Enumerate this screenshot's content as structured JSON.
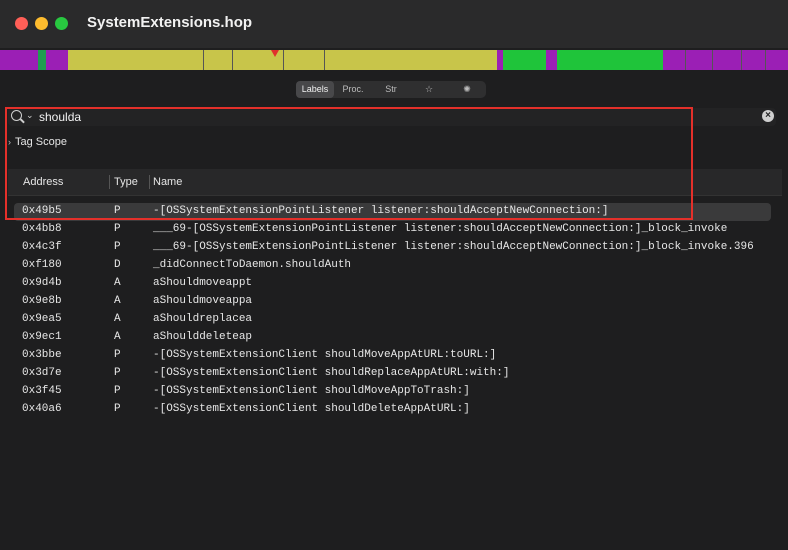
{
  "window": {
    "title": "SystemExtensions.hop"
  },
  "nav_segments": [
    {
      "color": "#9b1fb5",
      "start": 0,
      "end": 38
    },
    {
      "color": "#1f9e50",
      "start": 38,
      "end": 46
    },
    {
      "color": "#9b1fb5",
      "start": 46,
      "end": 68
    },
    {
      "color": "#c8c54a",
      "start": 68,
      "end": 497
    },
    {
      "color": "#9b1fb5",
      "start": 497,
      "end": 503
    },
    {
      "color": "#1fc43a",
      "start": 503,
      "end": 546
    },
    {
      "color": "#9b1fb5",
      "start": 546,
      "end": 557
    },
    {
      "color": "#1fc43a",
      "start": 557,
      "end": 663
    },
    {
      "color": "#9b1fb5",
      "start": 663,
      "end": 788
    }
  ],
  "tabs": [
    "Labels",
    "Proc.",
    "Str",
    "☆",
    "✺"
  ],
  "search": {
    "value": "shoulda"
  },
  "tag_scope": {
    "label": "Tag Scope"
  },
  "columns": {
    "address": "Address",
    "type": "Type",
    "name": "Name"
  },
  "rows": [
    {
      "address": "0x49b5",
      "type": "P",
      "name": "-[OSSystemExtensionPointListener listener:shouldAcceptNewConnection:]"
    },
    {
      "address": "0x4bb8",
      "type": "P",
      "name": "___69-[OSSystemExtensionPointListener listener:shouldAcceptNewConnection:]_block_invoke"
    },
    {
      "address": "0x4c3f",
      "type": "P",
      "name": "___69-[OSSystemExtensionPointListener listener:shouldAcceptNewConnection:]_block_invoke.396"
    },
    {
      "address": "0xf180",
      "type": "D",
      "name": "_didConnectToDaemon.shouldAuth"
    },
    {
      "address": "0x9d4b",
      "type": "A",
      "name": "aShouldmoveappt"
    },
    {
      "address": "0x9e8b",
      "type": "A",
      "name": "aShouldmoveappa"
    },
    {
      "address": "0x9ea5",
      "type": "A",
      "name": "aShouldreplacea"
    },
    {
      "address": "0x9ec1",
      "type": "A",
      "name": "aShoulddeleteap"
    },
    {
      "address": "0x3bbe",
      "type": "P",
      "name": "-[OSSystemExtensionClient shouldMoveAppAtURL:toURL:]"
    },
    {
      "address": "0x3d7e",
      "type": "P",
      "name": "-[OSSystemExtensionClient shouldReplaceAppAtURL:with:]"
    },
    {
      "address": "0x3f45",
      "type": "P",
      "name": "-[OSSystemExtensionClient shouldMoveAppToTrash:]"
    },
    {
      "address": "0x40a6",
      "type": "P",
      "name": "-[OSSystemExtensionClient shouldDeleteAppAtURL:]"
    }
  ],
  "colors": {
    "highlight_box": "#e4302a",
    "selection": "#3a3a3b"
  }
}
